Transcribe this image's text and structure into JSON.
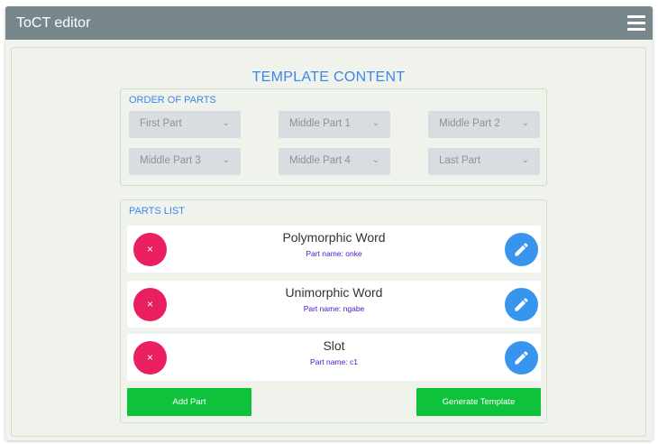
{
  "app": {
    "title": "ToCT editor",
    "menu_icon": "hamburger-menu-icon"
  },
  "content": {
    "title": "TEMPLATE CONTENT",
    "order": {
      "label": "ORDER OF PARTS",
      "selects": [
        "First Part",
        "Middle Part 1",
        "Middle Part 2",
        "Middle Part 3",
        "Middle Part 4",
        "Last Part"
      ]
    },
    "parts": {
      "label": "PARTS LIST",
      "items": [
        {
          "title": "Polymorphic Word",
          "subtitle": "Part name: onke"
        },
        {
          "title": "Unimorphic Word",
          "subtitle": "Part name: ngabe"
        },
        {
          "title": "Slot",
          "subtitle": "Part name: c1"
        }
      ],
      "delete_glyph": "×",
      "add_label": "Add Part",
      "generate_label": "Generate Template"
    }
  },
  "colors": {
    "topbar": "#78878c",
    "accent": "#3d86ea",
    "delete": "#e91f5f",
    "edit": "#3795ee",
    "action": "#0ec33b",
    "subtitle": "#4b16c8"
  }
}
